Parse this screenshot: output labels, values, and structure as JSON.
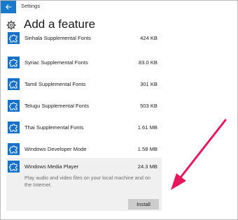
{
  "window": {
    "title": "Settings"
  },
  "page": {
    "title": "Add a feature"
  },
  "features": [
    {
      "name": "Sinhala Supplemental Fonts",
      "size": "424 KB"
    },
    {
      "name": "Syriac Supplemental Fonts",
      "size": "83.0 KB"
    },
    {
      "name": "Tamil Supplemental Fonts",
      "size": "301 KB"
    },
    {
      "name": "Telugu Supplemental Fonts",
      "size": "503 KB"
    },
    {
      "name": "Thai Supplemental Fonts",
      "size": "1.61 MB"
    },
    {
      "name": "Windows Developer Mode",
      "size": "1.58 MB"
    }
  ],
  "selected": {
    "name": "Windows Media Player",
    "size": "24.3 MB",
    "description": "Play audio and video files on your local machine and on the Internet.",
    "install_label": "Install"
  },
  "colors": {
    "accent": "#1979ca",
    "feature_icon": "#1672c8",
    "annotation_arrow": "#e8175d"
  },
  "icons": {
    "back": "back-arrow-icon",
    "header": "gear-icon",
    "feature": "puzzle-piece-icon"
  }
}
